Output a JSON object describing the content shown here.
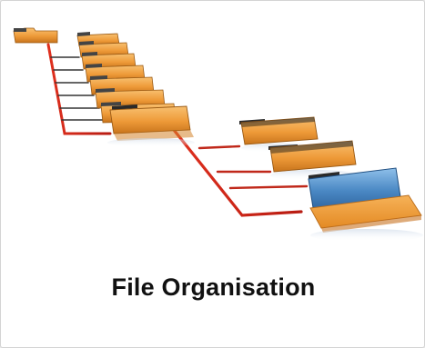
{
  "card": {
    "caption": "File Organisation"
  },
  "illustration": {
    "icon": "folder-tree-icon",
    "colors": {
      "folder_orange": "#f0a040",
      "folder_blue": "#3f79b4",
      "connector_red": "#d8281e"
    }
  }
}
